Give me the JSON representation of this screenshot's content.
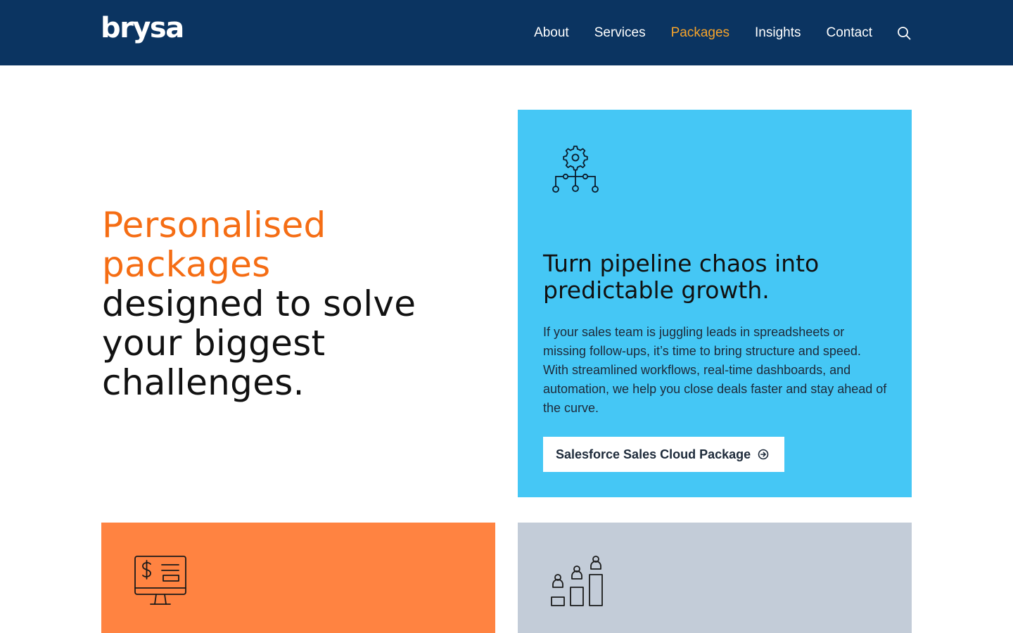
{
  "header": {
    "logo": "brysa",
    "nav": [
      {
        "label": "About",
        "active": false
      },
      {
        "label": "Services",
        "active": false
      },
      {
        "label": "Packages",
        "active": true
      },
      {
        "label": "Insights",
        "active": false
      },
      {
        "label": "Contact",
        "active": false
      }
    ],
    "search_icon": "search-icon"
  },
  "hero": {
    "heading_accent": "Personalised packages",
    "heading_rest": "designed to solve your biggest challenges."
  },
  "cards": [
    {
      "icon": "process-gear-icon",
      "title": "Turn pipeline chaos into predictable growth.",
      "body": "If your sales team is juggling leads in spreadsheets or missing follow-ups, it’s time to bring structure and speed. With streamlined workflows, real-time dashboards, and automation, we help you close deals faster and stay ahead of the curve.",
      "cta": "Salesforce Sales Cloud Package",
      "cta_icon": "arrow-circle-right-icon"
    },
    {
      "icon": "finance-monitor-icon"
    },
    {
      "icon": "people-growth-chart-icon"
    }
  ],
  "colors": {
    "header_bg": "#0b3461",
    "nav_active": "#f6a32a",
    "hero_accent": "#f56d14",
    "card_blue": "#45c7f5",
    "card_orange": "#ff8341",
    "card_grey": "#c3ccd8"
  }
}
